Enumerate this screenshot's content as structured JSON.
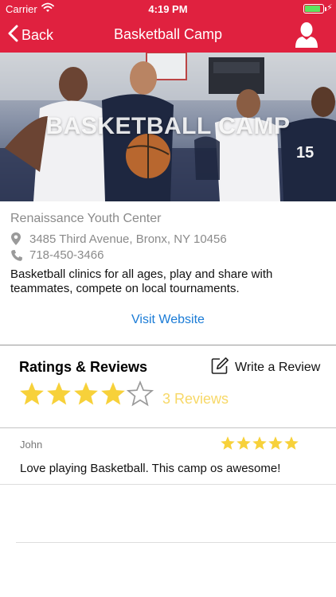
{
  "status_bar": {
    "carrier": "Carrier",
    "time": "4:19 PM",
    "battery_level": 0.9
  },
  "nav": {
    "back_label": "Back",
    "title": "Basketball Camp"
  },
  "hero": {
    "title": "BASKETBALL CAMP"
  },
  "venue": {
    "name": "Renaissance Youth Center",
    "address": "3485 Third Avenue, Bronx, NY 10456",
    "phone": "718-450-3466",
    "description": "Basketball clinics for all ages, play and share with teammates, compete on local tournaments.",
    "website_link": "Visit Website"
  },
  "ratings": {
    "title": "Ratings & Reviews",
    "write_review_label": "Write a Review",
    "average_rating": 4,
    "max_rating": 5,
    "count_label": "3 Reviews"
  },
  "reviews": [
    {
      "author": "John",
      "rating": 5,
      "text": "Love playing Basketball. This camp os awesome!"
    }
  ],
  "colors": {
    "brand_red": "#e0213f",
    "star_gold": "#f7d13a",
    "link_blue": "#1a7bd6",
    "review_count_yellow": "#f7d867"
  }
}
